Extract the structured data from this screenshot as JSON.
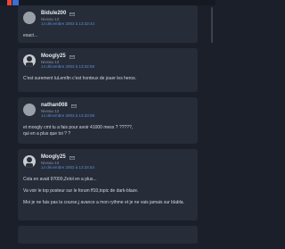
{
  "posts": [
    {
      "username": "Bidule200",
      "rank": "Niveau 13",
      "date": "14 décembre 2003 à 13:32:44",
      "avatar": "default-avatar",
      "lines": [
        "exact..."
      ]
    },
    {
      "username": "Moogly25",
      "rank": "Niveau 13",
      "date": "14 décembre 2003 à 13:32:59",
      "avatar": "user-avatar",
      "lines": [
        "C'est surement luLemfin c'est honteux de jouer les heros."
      ]
    },
    {
      "username": "nathan008",
      "rank": "Niveau 12",
      "date": "14 décembre 2003 à 13:33:08",
      "avatar": "default-avatar",
      "lines": [
        "et moogly cmt tu a fais pour avoir 41000 mess ? ?????,",
        "qui en a plus que toi ? ?"
      ]
    },
    {
      "username": "Moogly25",
      "rank": "Niveau 13",
      "date": "14 décembre 2003 à 13:34:54",
      "avatar": "user-avatar",
      "lines": [
        "Cola en avait 97000,Zelol en a plus...",
        "Va voir le top posteur sur le forum ff10,topic de dark-blaze.",
        "Moi je ne fais pas la course,j avance a mon rythme et je ne vais jamais sur blabla."
      ]
    }
  ],
  "colors": {
    "background": "#1b1f29",
    "card": "#262c38",
    "date": "#5b8fd6",
    "accent_logo": "#e8463c"
  }
}
